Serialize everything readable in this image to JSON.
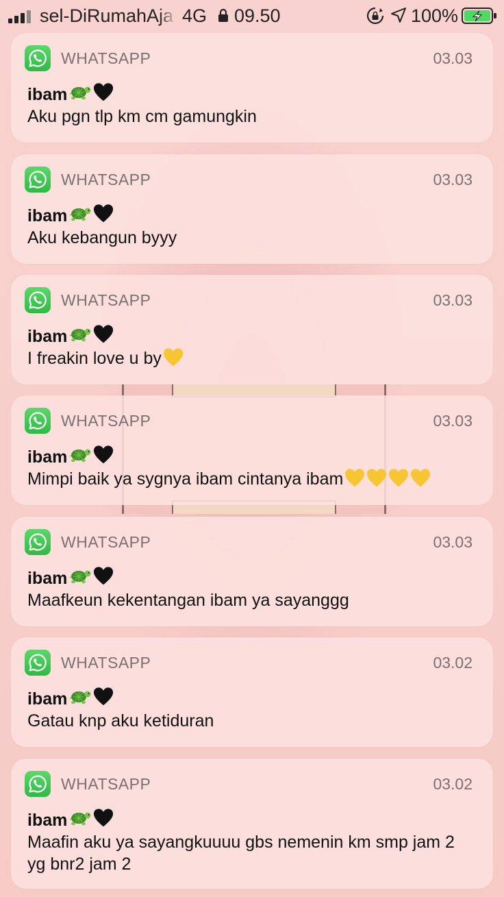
{
  "status_bar": {
    "carrier": "sel-DiRumahAja",
    "network": "4G",
    "time": "09.50",
    "battery": "100%"
  },
  "notifications": [
    {
      "app": "WHATSAPP",
      "time": "03.03",
      "sender": "ibam",
      "message": "Aku pgn tlp km cm gamungkin",
      "message_hearts": 0
    },
    {
      "app": "WHATSAPP",
      "time": "03.03",
      "sender": "ibam",
      "message": "Aku kebangun byyy",
      "message_hearts": 0
    },
    {
      "app": "WHATSAPP",
      "time": "03.03",
      "sender": "ibam",
      "message": "I freakin love u by",
      "message_hearts": 1
    },
    {
      "app": "WHATSAPP",
      "time": "03.03",
      "sender": "ibam",
      "message": "Mimpi baik ya sygnya ibam cintanya ibam",
      "message_hearts": 4
    },
    {
      "app": "WHATSAPP",
      "time": "03.03",
      "sender": "ibam",
      "message": "Maafkeun kekentangan ibam ya sayanggg",
      "message_hearts": 0
    },
    {
      "app": "WHATSAPP",
      "time": "03.02",
      "sender": "ibam",
      "message": "Gatau knp aku ketiduran",
      "message_hearts": 0
    },
    {
      "app": "WHATSAPP",
      "time": "03.02",
      "sender": "ibam",
      "message": "Maafin aku ya sayangkuuuu gbs nemenin km smp jam 2 yg bnr2 jam 2",
      "message_hearts": 0
    }
  ],
  "icons": {
    "app_icon": "whatsapp-icon",
    "sender_emoji_1": "turtle-emoji-icon",
    "sender_emoji_2": "black-heart-emoji-icon",
    "message_emoji": "yellow-heart-emoji-icon"
  },
  "colors": {
    "background": "#f7cfcb",
    "card": "#fde2df",
    "whatsapp_green": "#2fb945",
    "battery_green": "#4cd964",
    "yellow_heart": "#f7c531"
  }
}
